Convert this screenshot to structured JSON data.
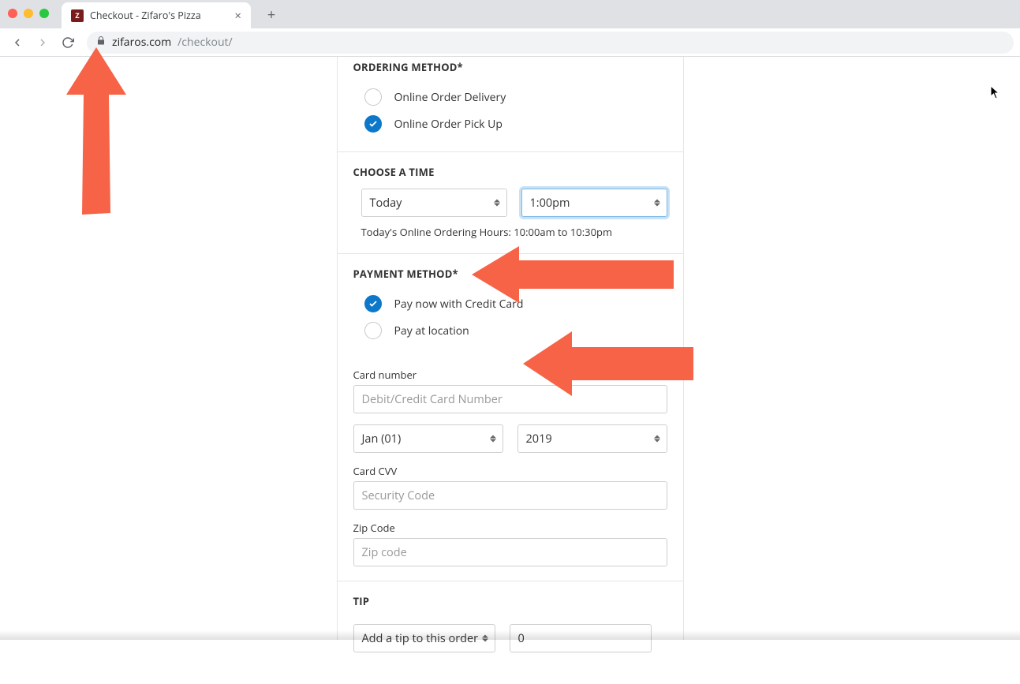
{
  "browser": {
    "tab_title": "Checkout - Zifaro's Pizza",
    "favicon_letter": "Z",
    "url_host": "zifaros.com",
    "url_path": "/checkout/"
  },
  "ordering_method": {
    "heading": "ORDERING METHOD*",
    "options": [
      {
        "label": "Online Order Delivery",
        "checked": false
      },
      {
        "label": "Online Order Pick Up",
        "checked": true
      }
    ]
  },
  "choose_time": {
    "heading": "CHOOSE A TIME",
    "day_value": "Today",
    "time_value": "1:00pm",
    "hours_note": "Today's Online Ordering Hours: 10:00am to 10:30pm"
  },
  "payment": {
    "heading": "PAYMENT METHOD*",
    "options": [
      {
        "label": "Pay now with Credit Card",
        "checked": true
      },
      {
        "label": "Pay at location",
        "checked": false
      }
    ],
    "card_number_label": "Card number",
    "card_number_placeholder": "Debit/Credit Card Number",
    "exp_month_value": "Jan (01)",
    "exp_year_value": "2019",
    "cvv_label": "Card CVV",
    "cvv_placeholder": "Security Code",
    "zip_label": "Zip Code",
    "zip_placeholder": "Zip code"
  },
  "tip": {
    "heading": "TIP",
    "select_value": "Add a tip to this order",
    "amount_value": "0"
  },
  "annotations": {
    "arrow_color": "#f76347"
  }
}
